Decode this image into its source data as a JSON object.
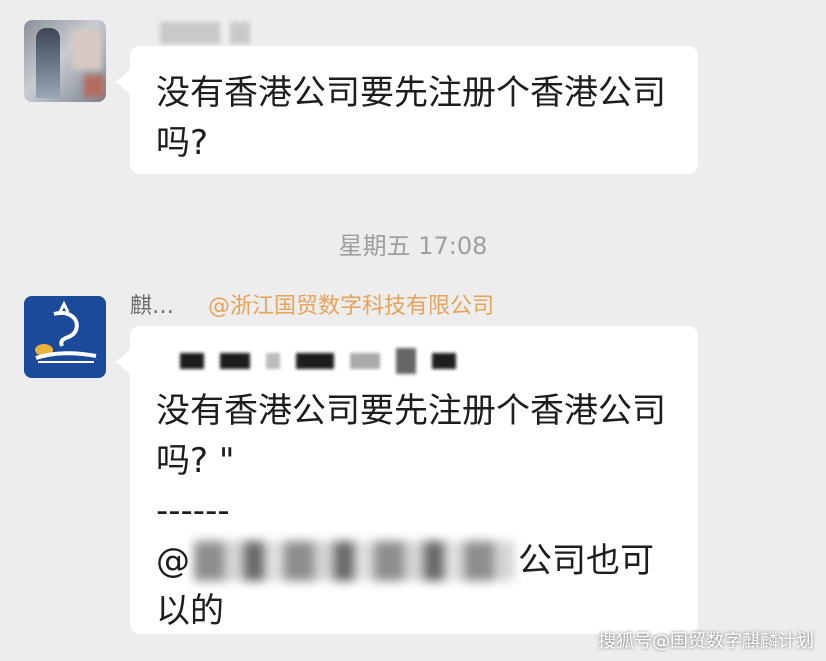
{
  "messages": [
    {
      "text_lines": [
        "没有香港公司要先注册个香港公司",
        "吗?"
      ]
    },
    {
      "sender_name": "麒…",
      "sender_tag": "@浙江国贸数字科技有限公司",
      "quote_lines": [
        "没有香港公司要先注册个香港公司",
        "吗? \""
      ],
      "separator": "------",
      "mention_prefix": "@",
      "mention_suffix": "公司也可",
      "last_line": "以的"
    }
  ],
  "timestamp": "星期五 17:08",
  "watermark": "搜狐号@国贸数字麒麟计划",
  "icons": [
    "building-avatar-icon",
    "dragon-logo-icon"
  ],
  "colors": {
    "background": "#ededed",
    "bubble": "#ffffff",
    "tag": "#e8a35a",
    "timestamp": "#9e9e9e"
  }
}
